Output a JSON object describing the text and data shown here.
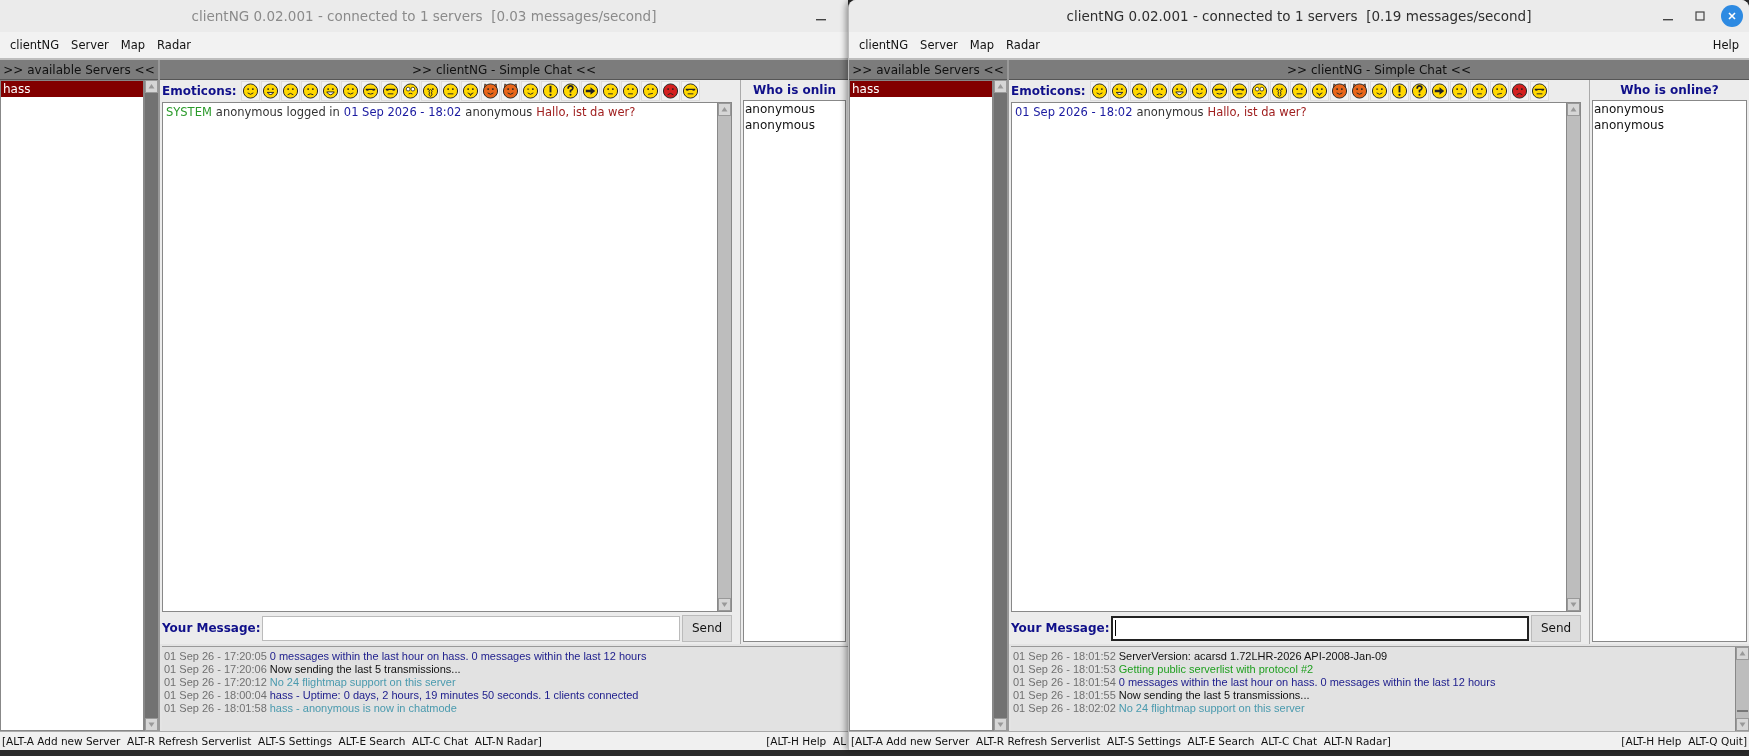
{
  "windows": [
    {
      "title": "clientNG 0.02.001 - connected to 1 servers  [0.03 messages/second]",
      "active": false,
      "controls": [
        {
          "kind": "minimize"
        }
      ],
      "menu": [
        "clientNG",
        "Server",
        "Map",
        "Radar"
      ],
      "servers_header": ">> available Servers <<",
      "servers": [
        {
          "name": "hass",
          "selected": true
        }
      ],
      "chat_header": ">> clientNG - Simple Chat <<",
      "emoticons_label": "Emoticons:",
      "emoticons": [
        {
          "kind": "happy"
        },
        {
          "kind": "grin"
        },
        {
          "kind": "sad"
        },
        {
          "kind": "worried"
        },
        {
          "kind": "laugh"
        },
        {
          "kind": "smile"
        },
        {
          "kind": "cool"
        },
        {
          "kind": "shades"
        },
        {
          "kind": "dizzy"
        },
        {
          "kind": "surprised"
        },
        {
          "kind": "wince"
        },
        {
          "kind": "tongue"
        },
        {
          "kind": "devil"
        },
        {
          "kind": "devil"
        },
        {
          "kind": "wink"
        },
        {
          "kind": "exclaim"
        },
        {
          "kind": "question"
        },
        {
          "kind": "arrow"
        },
        {
          "kind": "neutral"
        },
        {
          "kind": "neutral"
        },
        {
          "kind": "sleepy"
        },
        {
          "kind": "angry"
        },
        {
          "kind": "shades"
        }
      ],
      "chat_lines": [
        [
          {
            "kind": "system",
            "text": "SYSTEM"
          },
          {
            "kind": "plain",
            "text": "anonymous logged in"
          },
          {
            "kind": "date",
            "text": "01 Sep 2026 - 18:02"
          },
          {
            "kind": "plain",
            "text": "anonymous"
          },
          {
            "kind": "message",
            "text": "Hallo, ist da wer?"
          }
        ]
      ],
      "online_header": "Who is onlin",
      "online_users": [
        "anonymous",
        "anonymous"
      ],
      "message_label": "Your Message:",
      "message_focused": false,
      "send": "Send",
      "log": [
        {
          "time": "01 Sep 26 - 17:20:05",
          "text": "0 messages within the last hour on hass. 0 messages within the last 12 hours",
          "kind": "info"
        },
        {
          "time": "01 Sep 26 - 17:20:06",
          "text": "Now sending the last 5 transmissions...",
          "kind": "plain"
        },
        {
          "time": "01 Sep 26 - 17:20:12",
          "text": "No 24 flightmap support on this server",
          "kind": "notice"
        },
        {
          "time": "01 Sep 26 - 18:00:04",
          "text": "hass - Uptime: 0 days, 2 hours, 19 minutes 50 seconds. 1 clients connected",
          "kind": "info"
        },
        {
          "time": "01 Sep 26 - 18:01:58",
          "text": "hass - anonymous is now in chatmode",
          "kind": "notice"
        }
      ],
      "status_left": "[ALT-A Add new Server  ALT-R Refresh Serverlist  ALT-S Settings  ALT-E Search  ALT-C Chat  ALT-N Radar]",
      "status_right": "[ALT-H Help  AL"
    },
    {
      "title": "clientNG 0.02.001 - connected to 1 servers  [0.19 messages/second]",
      "active": true,
      "controls": [
        {
          "kind": "minimize"
        },
        {
          "kind": "maximize"
        },
        {
          "kind": "close"
        }
      ],
      "menu": [
        "clientNG",
        "Server",
        "Map",
        "Radar"
      ],
      "menu_right": [
        "Help"
      ],
      "servers_header": ">> available Servers <<",
      "servers": [
        {
          "name": "hass",
          "selected": true
        }
      ],
      "chat_header": ">> clientNG - Simple Chat <<",
      "emoticons_label": "Emoticons:",
      "emoticons": [
        {
          "kind": "happy"
        },
        {
          "kind": "grin"
        },
        {
          "kind": "sad"
        },
        {
          "kind": "worried"
        },
        {
          "kind": "laugh"
        },
        {
          "kind": "smile"
        },
        {
          "kind": "cool"
        },
        {
          "kind": "shades"
        },
        {
          "kind": "dizzy"
        },
        {
          "kind": "surprised"
        },
        {
          "kind": "wince"
        },
        {
          "kind": "tongue"
        },
        {
          "kind": "devil"
        },
        {
          "kind": "devil"
        },
        {
          "kind": "wink"
        },
        {
          "kind": "exclaim"
        },
        {
          "kind": "question"
        },
        {
          "kind": "arrow"
        },
        {
          "kind": "neutral"
        },
        {
          "kind": "neutral"
        },
        {
          "kind": "sleepy"
        },
        {
          "kind": "angry"
        },
        {
          "kind": "shades"
        }
      ],
      "chat_lines": [
        [
          {
            "kind": "date",
            "text": "01 Sep 2026 - 18:02"
          },
          {
            "kind": "plain",
            "text": "anonymous"
          },
          {
            "kind": "message",
            "text": "Hallo, ist da wer?"
          }
        ]
      ],
      "online_header": "Who is online?",
      "online_users": [
        "anonymous",
        "anonymous"
      ],
      "message_label": "Your Message:",
      "message_focused": true,
      "send": "Send",
      "log": [
        {
          "time": "01 Sep 26 - 18:01:52",
          "text": "ServerVersion: acarsd 1.72LHR-2026 API-2008-Jan-09",
          "kind": "plain"
        },
        {
          "time": "01 Sep 26 - 18:01:53",
          "text": "Getting public serverlist with protocol #2",
          "kind": "success"
        },
        {
          "time": "01 Sep 26 - 18:01:54",
          "text": "0 messages within the last hour on hass. 0 messages within the last 12 hours",
          "kind": "info"
        },
        {
          "time": "01 Sep 26 - 18:01:55",
          "text": "Now sending the last 5 transmissions...",
          "kind": "plain"
        },
        {
          "time": "01 Sep 26 - 18:02:02",
          "text": "No 24 flightmap support on this server",
          "kind": "notice"
        }
      ],
      "status_left": "[ALT-A Add new Server  ALT-R Refresh Serverlist  ALT-S Settings  ALT-E Search  ALT-C Chat  ALT-N Radar]",
      "status_right": "[ALT-H Help  ALT-Q Quit]"
    }
  ]
}
